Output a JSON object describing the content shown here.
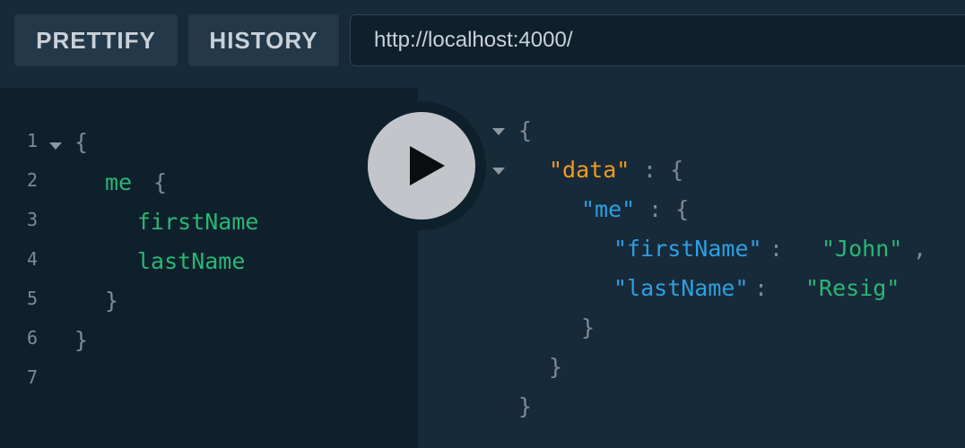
{
  "toolbar": {
    "prettify_label": "PRETTIFY",
    "history_label": "HISTORY",
    "endpoint_url": "http://localhost:4000/"
  },
  "editor": {
    "line_numbers": [
      "1",
      "2",
      "3",
      "4",
      "5",
      "6",
      "7"
    ],
    "lines": {
      "open_brace": "{",
      "me": "me",
      "me_brace": "{",
      "first_name": "firstName",
      "last_name": "lastName",
      "inner_close": "}",
      "outer_close": "}"
    }
  },
  "results": {
    "open_brace": "{",
    "data_key": "\"data\"",
    "data_colon_brace": ": {",
    "me_key": "\"me\"",
    "me_colon_brace": ": {",
    "first_name_key": "\"firstName\"",
    "first_name_colon": ": ",
    "first_name_value": "\"John\"",
    "comma": ",",
    "last_name_key": "\"lastName\"",
    "last_name_colon": ": ",
    "last_name_value": "\"Resig\"",
    "close_me": "}",
    "close_data": "}",
    "close_root": "}"
  },
  "icons": {
    "run": "play-icon",
    "fold": "fold-arrow-icon"
  },
  "colors": {
    "background": "#172a3a",
    "editor_background": "#0f202d",
    "field": "#2bb673",
    "key": "#2d9fe0",
    "top_key": "#f29a1f",
    "punctuation": "#7f8a93",
    "run_button": "#c2c6ca"
  }
}
